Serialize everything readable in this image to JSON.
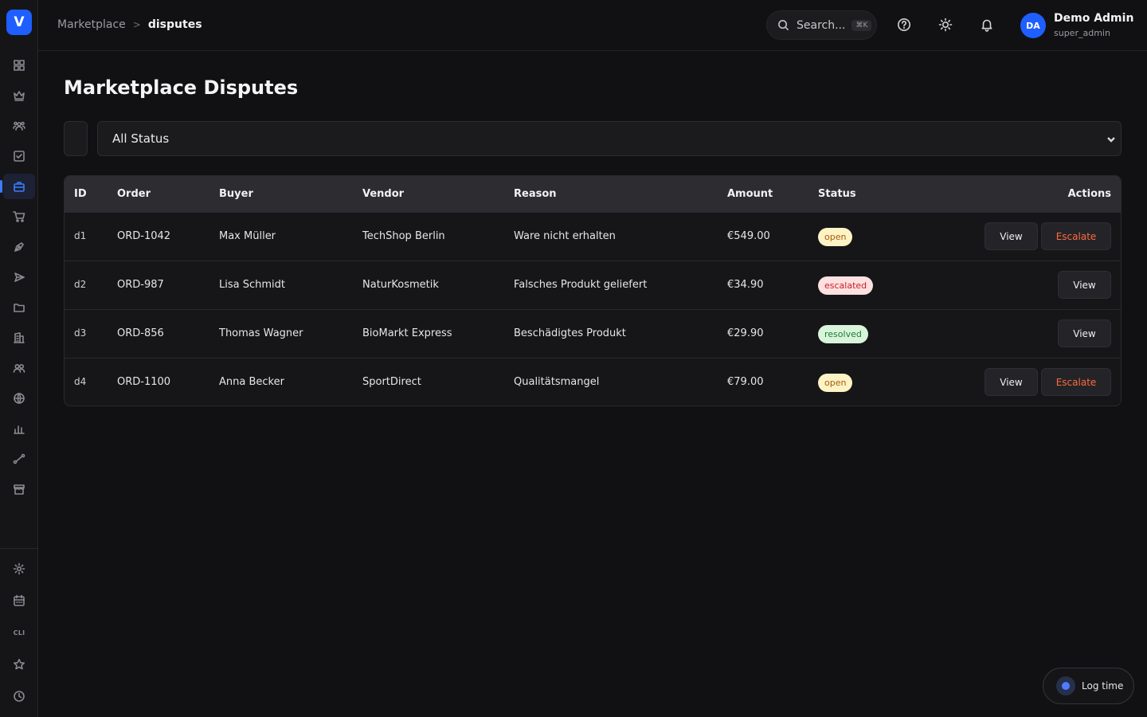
{
  "app": {
    "logo_letter": "V"
  },
  "sidebar": {
    "items": [
      {
        "name": "dashboard-grid-icon",
        "active": false
      },
      {
        "name": "crown-icon",
        "active": false
      },
      {
        "name": "users-group-icon",
        "active": false
      },
      {
        "name": "checkbox-icon",
        "active": false
      },
      {
        "name": "briefcase-icon",
        "active": true
      },
      {
        "name": "cart-icon",
        "active": false
      },
      {
        "name": "pen-tool-icon",
        "active": false
      },
      {
        "name": "send-icon",
        "active": false
      },
      {
        "name": "folder-icon",
        "active": false
      },
      {
        "name": "building-icon",
        "active": false
      },
      {
        "name": "people-icon",
        "active": false
      },
      {
        "name": "globe-icon",
        "active": false
      },
      {
        "name": "bar-chart-icon",
        "active": false
      },
      {
        "name": "route-icon",
        "active": false
      },
      {
        "name": "store-icon",
        "active": false
      }
    ],
    "bottom": {
      "settings_icon": "gear-icon",
      "calendar_icon": "calendar-icon",
      "cli_label": "CLI",
      "star_icon": "star-icon",
      "history_icon": "clock-icon"
    }
  },
  "header": {
    "breadcrumb": {
      "parent": "Marketplace",
      "separator": ">",
      "current": "disputes"
    },
    "search": {
      "placeholder": "Search...",
      "shortcut": "⌘K"
    },
    "icons": [
      "help-icon",
      "sun-icon",
      "bell-icon"
    ],
    "user": {
      "initials": "DA",
      "name": "Demo Admin",
      "role": "super_admin"
    }
  },
  "main": {
    "title": "Marketplace Disputes",
    "filter": {
      "selected": "All Status"
    },
    "table": {
      "columns": {
        "id": "ID",
        "order": "Order",
        "buyer": "Buyer",
        "vendor": "Vendor",
        "reason": "Reason",
        "amount": "Amount",
        "status": "Status",
        "actions": "Actions"
      },
      "rows": [
        {
          "id": "d1",
          "order": "ORD-1042",
          "buyer": "Max Müller",
          "vendor": "TechShop Berlin",
          "reason": "Ware nicht erhalten",
          "amount": "€549.00",
          "status": "open",
          "view": "View",
          "escalate": "Escalate"
        },
        {
          "id": "d2",
          "order": "ORD-987",
          "buyer": "Lisa Schmidt",
          "vendor": "NaturKosmetik",
          "reason": "Falsches Produkt geliefert",
          "amount": "€34.90",
          "status": "escalated",
          "view": "View"
        },
        {
          "id": "d3",
          "order": "ORD-856",
          "buyer": "Thomas Wagner",
          "vendor": "BioMarkt Express",
          "reason": "Beschädigtes Produkt",
          "amount": "€29.90",
          "status": "resolved",
          "view": "View"
        },
        {
          "id": "d4",
          "order": "ORD-1100",
          "buyer": "Anna Becker",
          "vendor": "SportDirect",
          "reason": "Qualitätsmangel",
          "amount": "€79.00",
          "status": "open",
          "view": "View",
          "escalate": "Escalate"
        }
      ]
    }
  },
  "status_colors": {
    "open": {
      "bg": "#fdf3c4",
      "fg": "#a8590a"
    },
    "escalated": {
      "bg": "#fde0e0",
      "fg": "#c8202a"
    },
    "resolved": {
      "bg": "#d8f5dc",
      "fg": "#1f7a34"
    }
  },
  "colors": {
    "accent": "#1f5eff",
    "escalate": "#ff6a3d",
    "background": "#111113"
  },
  "log_time": {
    "label": "Log time"
  }
}
